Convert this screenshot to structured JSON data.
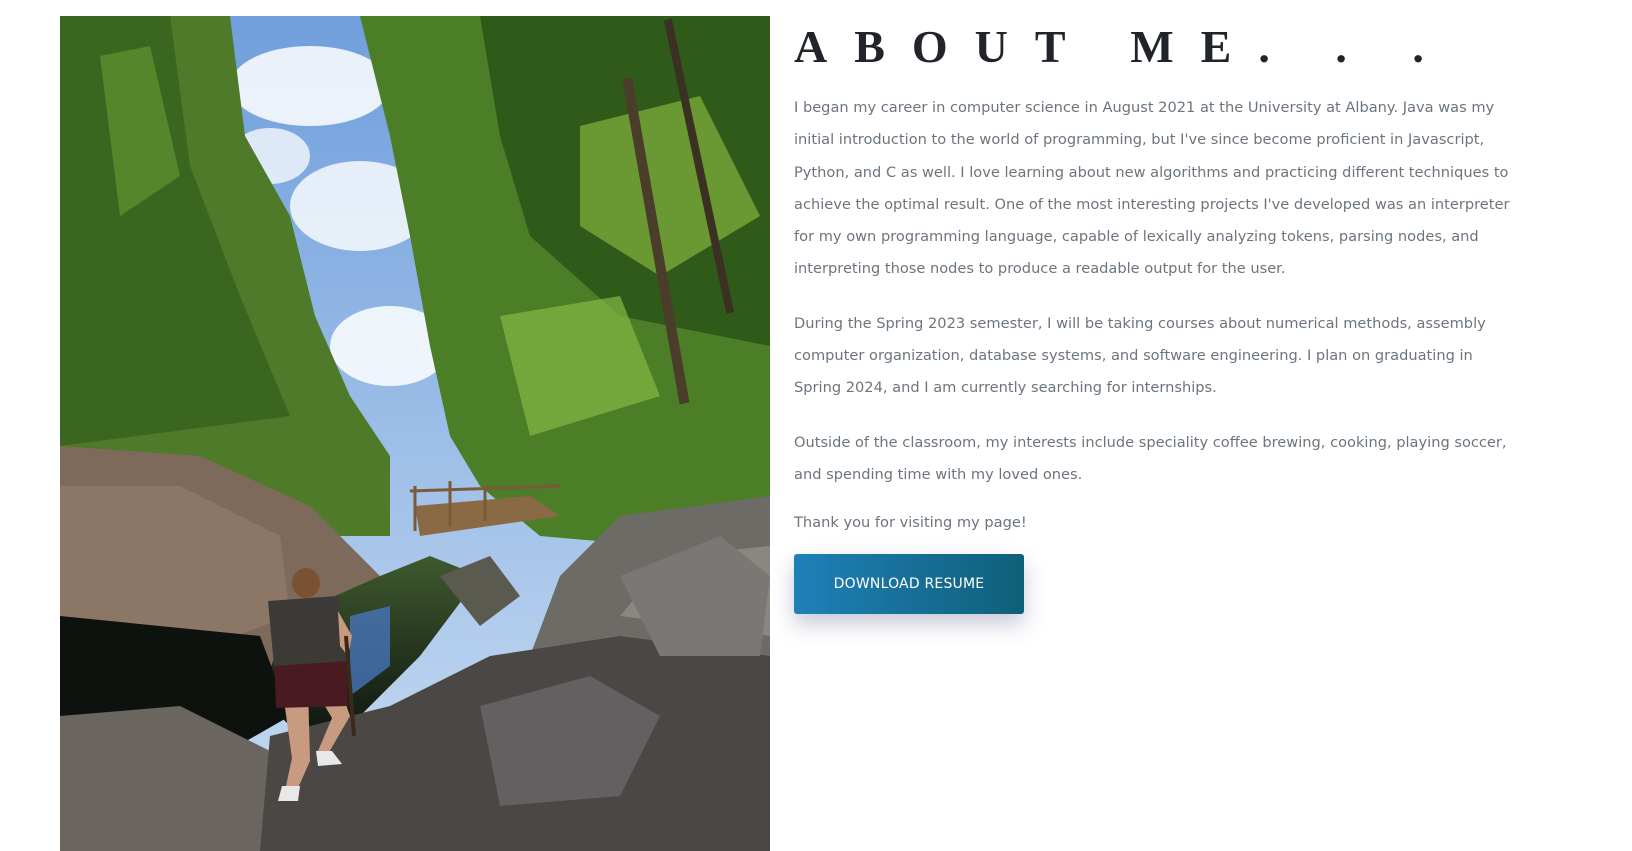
{
  "photo": {
    "alt": "Hiker standing on rocks beside a forest stream"
  },
  "about": {
    "title": "ABOUT ME. . .",
    "paragraphs": [
      "I began my career in computer science in August 2021 at the University at Albany. Java was my initial introduction to the world of programming, but I've since become proficient in Javascript, Python, and C as well. I love learning about new algorithms and practicing different techniques to achieve the optimal result. One of the most interesting projects I've developed was an interpreter for my own programming language, capable of lexically analyzing tokens, parsing nodes, and interpreting those nodes to produce a readable output for the user.",
      "During the Spring 2023 semester, I will be taking courses about numerical methods, assembly computer organization, database systems, and software engineering. I plan on graduating in Spring 2024, and I am currently searching for internships.",
      "Outside of the classroom, my interests include speciality coffee brewing, cooking, playing soccer, and spending time with my loved ones.",
      "Thank you for visiting my page!"
    ],
    "button_label": "DOWNLOAD RESUME"
  },
  "colors": {
    "title": "#212529",
    "body_text": "#6c757d",
    "button_start": "#1f80b8",
    "button_end": "#0f5f79"
  }
}
